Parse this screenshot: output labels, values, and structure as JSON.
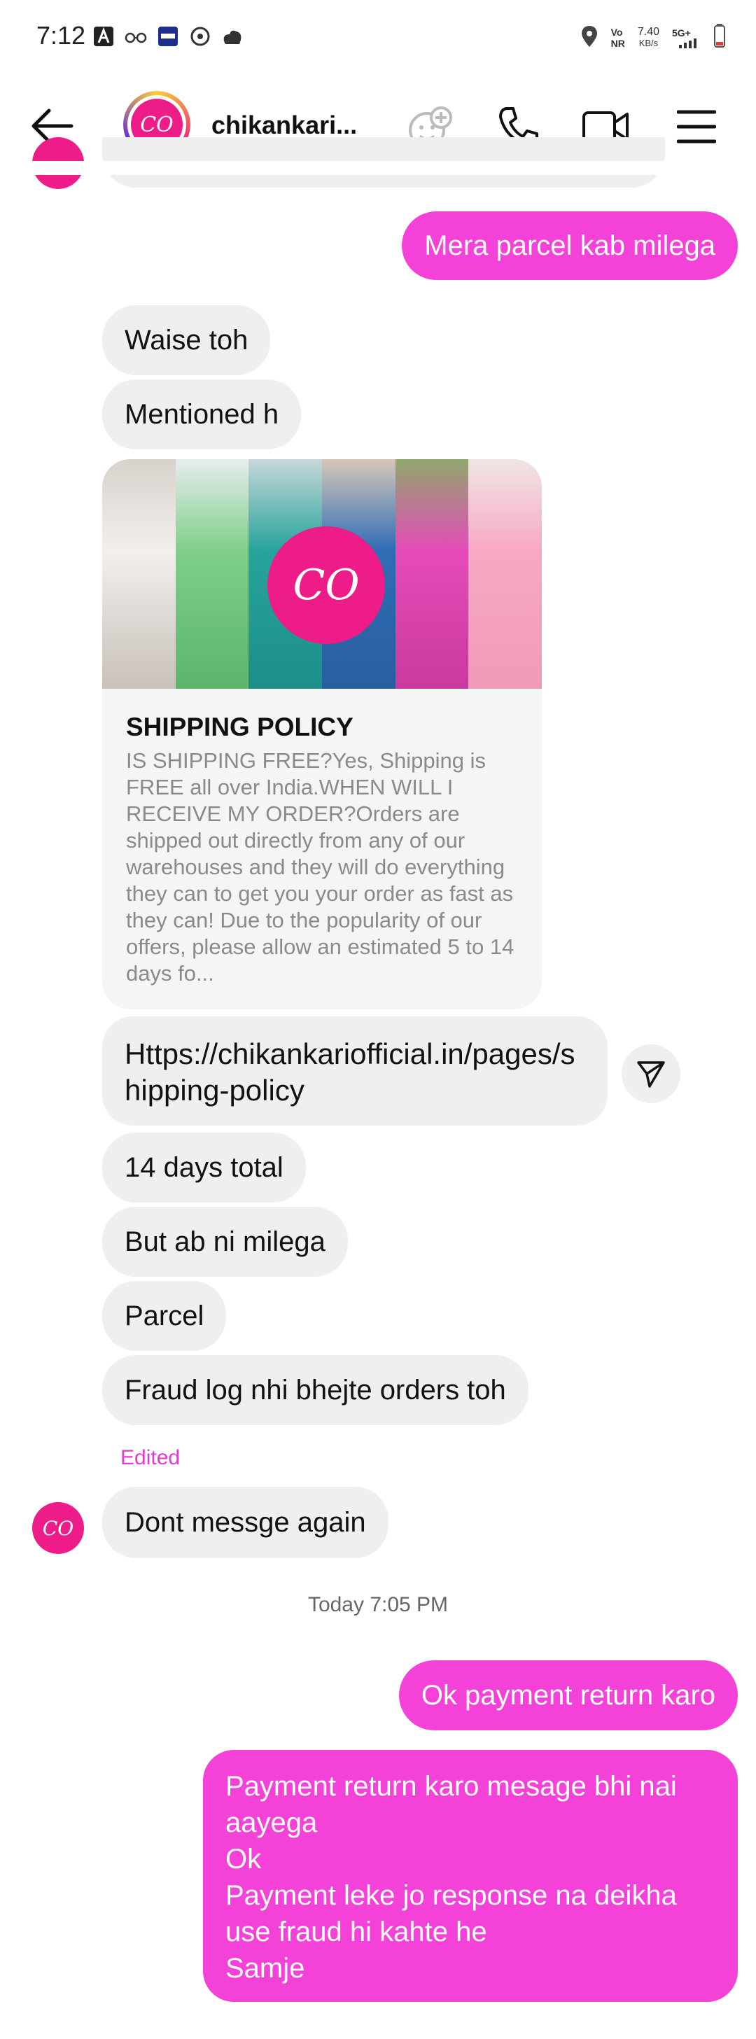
{
  "status_bar": {
    "time": "7:12",
    "net_label_top": "Vo",
    "net_label_bottom": "NR",
    "speed_top": "7.40",
    "speed_bottom": "KB/s",
    "network": "5G+"
  },
  "header": {
    "title": "chikankari...",
    "avatar_initials": "CO"
  },
  "messages": {
    "partial_top_out": "",
    "out_1": "Mera parcel kab milega",
    "in_1": "Waise toh",
    "in_2": "Mentioned h",
    "card": {
      "logo": "CO",
      "title": "SHIPPING POLICY",
      "description": "IS SHIPPING FREE?Yes, Shipping is FREE all over India.WHEN WILL I RECEIVE MY ORDER?Orders are shipped out directly from any of our warehouses and they will do everything they can to get you your order as fast as they can! Due to the popularity of our offers, please allow an estimated 5 to 14 days fo..."
    },
    "link": "Https://chikankariofficial.in/pages/shipping-policy",
    "in_3": "14 days total",
    "in_4": "But ab ni milega",
    "in_5": "Parcel",
    "in_6": "Fraud log nhi bhejte orders toh",
    "edited_label": "Edited",
    "in_7": "Dont messge again",
    "timestamp": "Today 7:05 PM",
    "out_2": "Ok payment return karo",
    "out_3_lines": [
      "Payment return karo mesage bhi nai aayega",
      "Ok",
      "Payment leke jo response na deikha use fraud hi kahte he",
      "Samje"
    ]
  },
  "colors": {
    "outgoing": "#f442d8",
    "incoming": "#efefef",
    "brand": "#ed1c88"
  }
}
